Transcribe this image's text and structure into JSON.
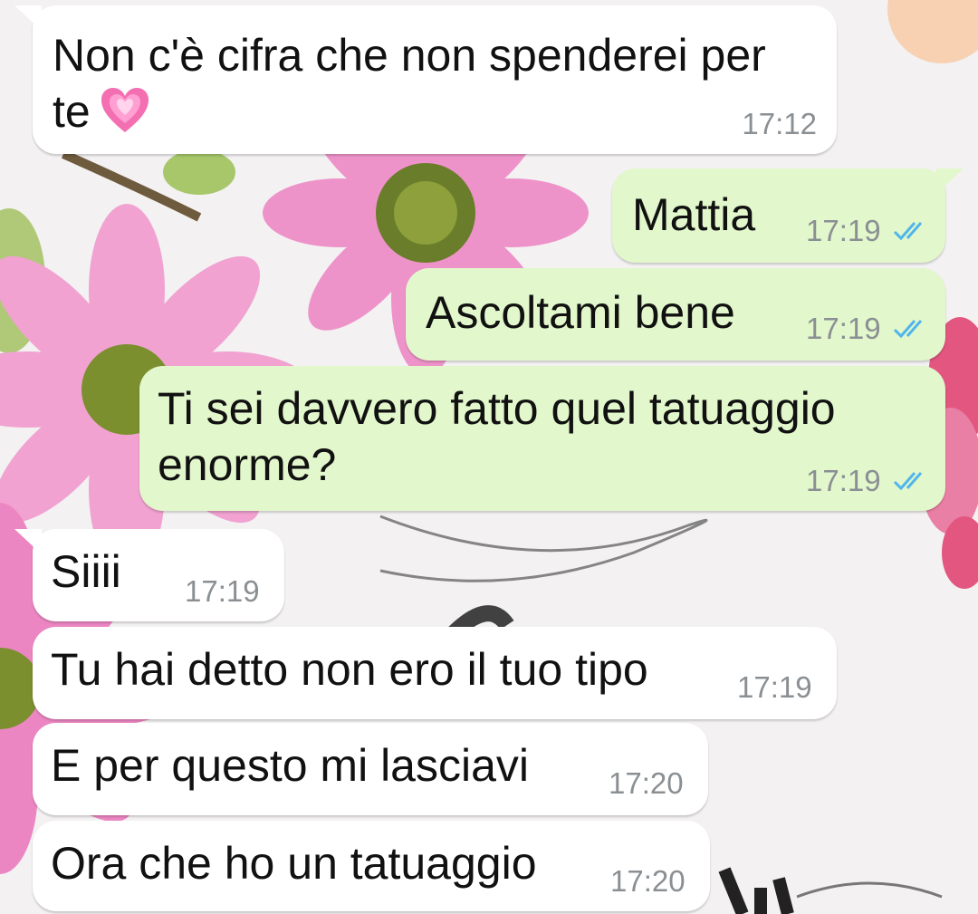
{
  "conversation": {
    "messages": [
      {
        "direction": "incoming",
        "text_line1": "Non c'è cifra che non spenderei per",
        "text_line2": "te",
        "emoji": "growing-heart",
        "time": "17:12"
      },
      {
        "direction": "outgoing",
        "text": "Mattia",
        "time": "17:19",
        "status": "read"
      },
      {
        "direction": "outgoing",
        "text": "Ascoltami bene",
        "time": "17:19",
        "status": "read"
      },
      {
        "direction": "outgoing",
        "text_line1": "Ti sei davvero fatto quel tatuaggio",
        "text_line2": "enorme?",
        "time": "17:19",
        "status": "read"
      },
      {
        "direction": "incoming",
        "text": "Siiii",
        "time": "17:19"
      },
      {
        "direction": "incoming",
        "text": "Tu hai detto non ero il tuo tipo",
        "time": "17:19"
      },
      {
        "direction": "incoming",
        "text": "E per questo mi lasciavi",
        "time": "17:20"
      },
      {
        "direction": "incoming",
        "text": "Ora che ho un tatuaggio",
        "time": "17:20"
      }
    ]
  },
  "colors": {
    "incoming_bubble": "#ffffff",
    "outgoing_bubble": "#e2f7cb",
    "timestamp": "#8a8f93",
    "read_ticks": "#4fb6ec",
    "wallpaper_flowers": "#e88ac4"
  },
  "icons": {
    "read_receipt": "double-check-icon",
    "emoji": "growing-heart-emoji"
  }
}
